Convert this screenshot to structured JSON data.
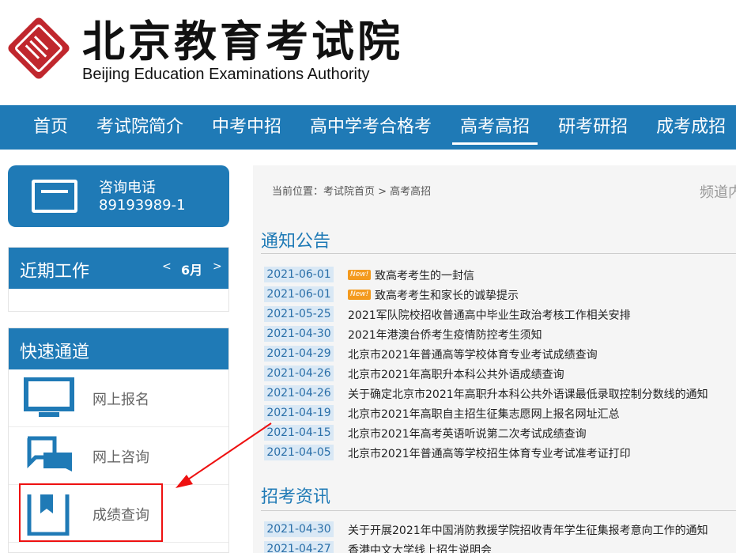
{
  "header": {
    "logo_cn": "北京教育考试院",
    "logo_en": "Beijing Education Examinations Authority"
  },
  "nav": {
    "items": [
      "首页",
      "考试院简介",
      "中考中招",
      "高中学考合格考",
      "高考高招",
      "研考研招",
      "成考成招"
    ],
    "active": "高考高招"
  },
  "phone": {
    "label": "咨询电话",
    "number": "89193989-1"
  },
  "recent": {
    "title": "近期工作",
    "prev": "<",
    "month": "6月",
    "next": ">"
  },
  "quick": {
    "title": "快速通道",
    "items": [
      {
        "label": "网上报名",
        "icon": "monitor-icon"
      },
      {
        "label": "网上咨询",
        "icon": "chat-icon"
      },
      {
        "label": "成绩查询",
        "icon": "bookmark-book-icon"
      }
    ]
  },
  "main": {
    "breadcrumb": "当前位置：考试院首页 > 高考高招",
    "channel": "频道内",
    "sections": [
      {
        "title": "通知公告",
        "items": [
          {
            "date": "2021-06-01",
            "new": "New!",
            "title": "致高考考生的一封信"
          },
          {
            "date": "2021-06-01",
            "new": "New!",
            "title": "致高考考生和家长的诚挚提示"
          },
          {
            "date": "2021-05-25",
            "title": "2021军队院校招收普通高中毕业生政治考核工作相关安排"
          },
          {
            "date": "2021-04-30",
            "title": "2021年港澳台侨考生疫情防控考生须知"
          },
          {
            "date": "2021-04-29",
            "title": "北京市2021年普通高等学校体育专业考试成绩查询"
          },
          {
            "date": "2021-04-26",
            "title": "北京市2021年高职升本科公共外语成绩查询"
          },
          {
            "date": "2021-04-26",
            "title": "关于确定北京市2021年高职升本科公共外语课最低录取控制分数线的通知"
          },
          {
            "date": "2021-04-19",
            "title": "北京市2021年高职自主招生征集志愿网上报名网址汇总"
          },
          {
            "date": "2021-04-15",
            "title": "北京市2021年高考英语听说第二次考试成绩查询"
          },
          {
            "date": "2021-04-05",
            "title": "北京市2021年普通高等学校招生体育专业考试准考证打印"
          }
        ]
      },
      {
        "title": "招考资讯",
        "items": [
          {
            "date": "2021-04-30",
            "title": "关于开展2021年中国消防救援学院招收青年学生征集报考意向工作的通知"
          },
          {
            "date": "2021-04-27",
            "title": "香港中文大学线上招生说明会"
          }
        ]
      }
    ]
  },
  "colors": {
    "brand": "#1f7ab6",
    "logo_red": "#c0272d",
    "annotation": "#e11111",
    "new_badge": "#f39a1e"
  }
}
